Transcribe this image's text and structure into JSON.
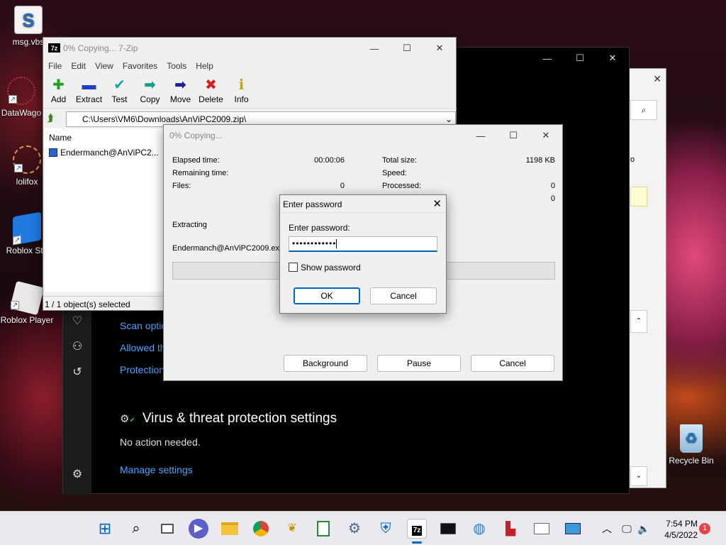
{
  "desktop": {
    "icons": [
      {
        "label": "msg.vbs",
        "icon": "vbs-script-icon"
      },
      {
        "label": "DataWago",
        "icon": "datawagon-icon"
      },
      {
        "label": "lolifox",
        "icon": "lolifox-icon"
      },
      {
        "label": "Roblox Stu",
        "icon": "roblox-studio-icon"
      },
      {
        "label": "Roblox Player",
        "icon": "roblox-player-icon"
      },
      {
        "label": "Recycle Bin",
        "icon": "recycle-bin-icon"
      }
    ]
  },
  "defender": {
    "links": [
      "Scan optio",
      "Allowed th",
      "Protection"
    ],
    "section_title": "Virus & threat protection settings",
    "section_status": "No action needed.",
    "manage_link": "Manage settings",
    "peek_text": "o"
  },
  "zip_window": {
    "title": "0% Copying... 7-Zip",
    "logo": "7z",
    "menu": [
      "File",
      "Edit",
      "View",
      "Favorites",
      "Tools",
      "Help"
    ],
    "toolbar": [
      {
        "label": "Add",
        "icon": "add-icon",
        "glyph": "✚",
        "color": "#1aa51a"
      },
      {
        "label": "Extract",
        "icon": "extract-icon",
        "glyph": "▬",
        "color": "#1e3fbf"
      },
      {
        "label": "Test",
        "icon": "test-icon",
        "glyph": "✔",
        "color": "#18a5a5"
      },
      {
        "label": "Copy",
        "icon": "copy-icon",
        "glyph": "➡",
        "color": "#1c9c8c"
      },
      {
        "label": "Move",
        "icon": "move-icon",
        "glyph": "➡",
        "color": "#18209a"
      },
      {
        "label": "Delete",
        "icon": "delete-icon",
        "glyph": "✖",
        "color": "#d42020"
      },
      {
        "label": "Info",
        "icon": "info-icon",
        "glyph": "ℹ",
        "color": "#c8a500"
      }
    ],
    "address": "C:\\Users\\VM6\\Downloads\\AnViPC2009.zip\\",
    "column_name": "Name",
    "file": "Endermanch@AnViPC2...",
    "status": "1 / 1 object(s) selected"
  },
  "progress_window": {
    "title": "0% Copying...",
    "elapsed_label": "Elapsed time:",
    "elapsed_value": "00:00:06",
    "remaining_label": "Remaining time:",
    "files_label": "Files:",
    "files_value": "0",
    "total_size_label": "Total size:",
    "total_size_value": "1198 KB",
    "speed_label": "Speed:",
    "processed_label": "Processed:",
    "processed_value": "0",
    "compressed_value": "0",
    "operation": "Extracting",
    "current_file": "Endermanch@AnViPC2009.exe",
    "progress": 0,
    "buttons": {
      "background": "Background",
      "pause": "Pause",
      "cancel": "Cancel"
    }
  },
  "password_dialog": {
    "title": "Enter password",
    "prompt": "Enter password:",
    "value": "••••••••••••",
    "show_password": "Show password",
    "show_password_checked": false,
    "ok": "OK",
    "cancel": "Cancel"
  },
  "taskbar": {
    "time": "7:54 PM",
    "date": "4/5/2022",
    "notifications": "1",
    "apps": [
      "start-icon",
      "search-icon",
      "task-view-icon",
      "teams-chat-icon",
      "file-explorer-icon",
      "chrome-icon",
      "firefox-icon",
      "notepad-icon",
      "settings-icon",
      "defender-icon",
      "sevenzip-icon",
      "terminal-icon",
      "browser-icon",
      "paint-icon",
      "reader-icon",
      "remote-desktop-icon"
    ]
  }
}
